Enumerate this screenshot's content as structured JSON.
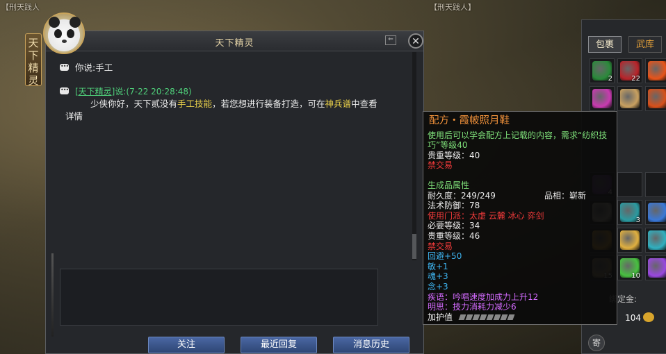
{
  "background": {
    "npc_label_left": "【刑天践人",
    "npc_label_right": "【刑天践人】"
  },
  "side_tab": {
    "label": "天下精灵"
  },
  "chat_window": {
    "title": "天下精灵",
    "close_symbol": "✕",
    "min_symbol": "⇐",
    "messages": {
      "user": {
        "text": "你说:手工"
      },
      "system": {
        "sender_link": "[天下精灵]",
        "header_rest": "说:(7-22 20:28:48)",
        "body_part1": "少侠你好，天下贰没有",
        "keyword1": "手工技能",
        "body_part2": "，若您想进行装备打造，可在",
        "keyword2": "神兵谱",
        "body_part3": "中查看",
        "body_line2": "详情"
      }
    },
    "input_value": "",
    "buttons": {
      "follow": "关注",
      "recent_reply": "最近回复",
      "history": "消息历史"
    }
  },
  "inventory": {
    "tab_bag": "包裹",
    "tab_armory": "武库",
    "slots": [
      {
        "icon": "green-orb-icon",
        "count": "2",
        "color": "#2a8a3a"
      },
      {
        "icon": "red-gem-icon",
        "count": "22",
        "color": "#b8242a"
      },
      {
        "icon": "fire-icon",
        "count": "",
        "color": "#e8541a"
      },
      {
        "icon": "pink-star-icon",
        "count": "",
        "color": "#c83ab0"
      },
      {
        "icon": "recipe-scroll-icon",
        "count": "",
        "color": "#c8a060"
      },
      {
        "icon": "flame-ring-icon",
        "count": "",
        "color": "#d8501a"
      },
      {
        "icon": "purple-orb-icon",
        "count": "4",
        "color": "#6a3a8a"
      },
      {
        "icon": "paper-icon",
        "count": "",
        "color": "#b8b0a0"
      },
      {
        "icon": "teal-pot-icon",
        "count": "3",
        "color": "#2a9aa0"
      },
      {
        "icon": "blue-crystal-icon",
        "count": "",
        "color": "#3a78d8"
      },
      {
        "icon": "gold-scroll-icon",
        "count": "",
        "color": "#d8a030"
      },
      {
        "icon": "gold-cloth-icon",
        "count": "",
        "color": "#e0b040"
      },
      {
        "icon": "cyan-ring-icon",
        "count": "",
        "color": "#30b0c0"
      },
      {
        "icon": "parchment-icon",
        "count": "15",
        "color": "#a08a60"
      },
      {
        "icon": "green-apple-icon",
        "count": "10",
        "color": "#48c040"
      },
      {
        "icon": "violet-swirl-icon",
        "count": "",
        "color": "#9a48e0"
      }
    ],
    "gold_label": "绑定金:",
    "gold_value": "104",
    "send_label": "寄"
  },
  "tooltip": {
    "title": "配方・霞帔照月鞋",
    "desc": "使用后可以学会配方上记载的内容，需求“纺织技巧”等级40",
    "rarity": "贵重等级：40",
    "no_trade": "禁交易",
    "product_header": "生成品属性",
    "durability": "耐久度：249/249",
    "quality": "品相：崭新",
    "magic_def": "法术防御：78",
    "sect": "使用门派：太虚 云麓 冰心 弈剑",
    "req_level": "必要等级：34",
    "rarity2": "贵重等级：46",
    "no_trade2": "禁交易",
    "stat1": "回避+50",
    "stat2": "敏+1",
    "stat3": "魂+3",
    "stat4": "念+3",
    "skill1": "疾语：吟唱速度加成力上升12",
    "skill2": "明思：技力消耗力减少6",
    "protect": "加护值"
  }
}
